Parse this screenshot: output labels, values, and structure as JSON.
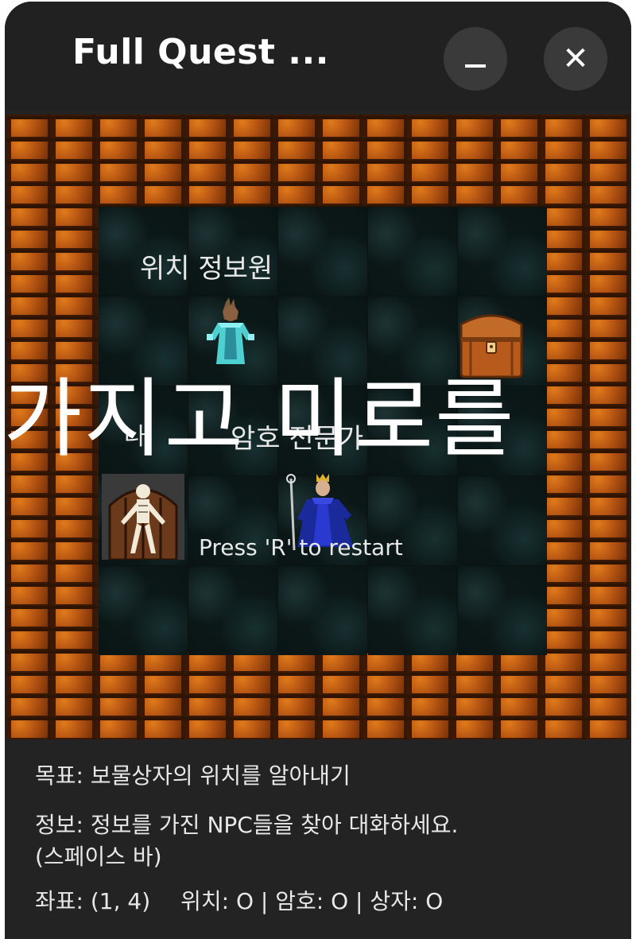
{
  "window": {
    "title": "Full Quest ...",
    "minimize_glyph": "minimize-icon",
    "close_label": "✕"
  },
  "board": {
    "npc_location_label": "위치 정보원",
    "player_label": "나",
    "npc_cipher_label": "암호 전문가",
    "overlay_text": "가지고 미로를",
    "restart_text": "Press 'R' to restart",
    "sprites": [
      "location-informant-npc",
      "treasure-chest",
      "player-skeleton",
      "cipher-expert-npc"
    ]
  },
  "info": {
    "goal": "목표: 보물상자의 위치를 알아내기",
    "hint_line1": "정보: 정보를 가진 NPC들을 찾아 대화하세요.",
    "hint_line2": "(스페이스 바)",
    "coords_label": "좌표: (1, 4)",
    "status": "위치: O | 암호: O | 상자: O"
  }
}
